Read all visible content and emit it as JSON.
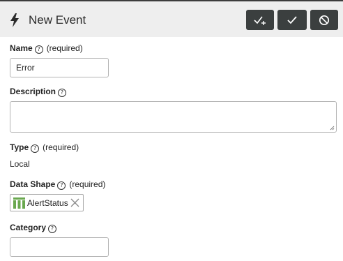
{
  "header": {
    "title": "New Event",
    "icon": "bolt-icon",
    "buttons": [
      {
        "name": "save-and-new-button",
        "icon": "check-plus-icon"
      },
      {
        "name": "save-button",
        "icon": "check-icon"
      },
      {
        "name": "cancel-button",
        "icon": "cancel-icon"
      }
    ],
    "button_color": "#3b3f3f"
  },
  "form": {
    "name": {
      "label": "Name",
      "help": "?",
      "required": "(required)",
      "value": "Error"
    },
    "description": {
      "label": "Description",
      "help": "?",
      "value": ""
    },
    "type": {
      "label": "Type",
      "help": "?",
      "required": "(required)",
      "value": "Local"
    },
    "data_shape": {
      "label": "Data Shape",
      "help": "?",
      "required": "(required)",
      "chip": "AlertStatus",
      "chip_icon_color": "#6aa84f"
    },
    "category": {
      "label": "Category",
      "help": "?",
      "value": ""
    }
  }
}
